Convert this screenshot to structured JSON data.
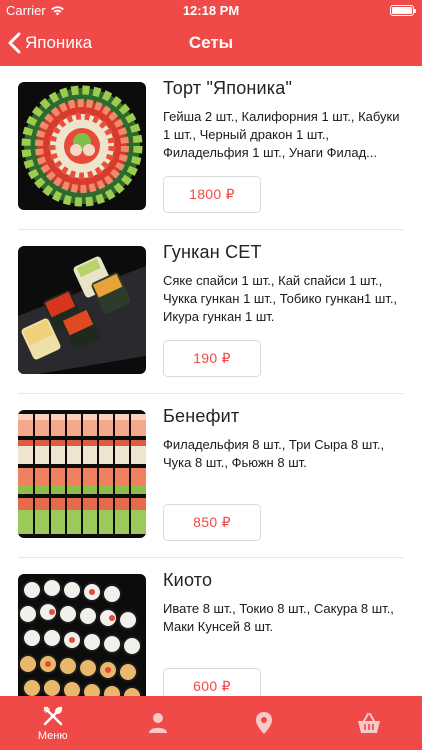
{
  "status_bar": {
    "carrier": "Carrier",
    "time": "12:18 PM"
  },
  "nav": {
    "back_label": "Японика",
    "title": "Сеты"
  },
  "items": [
    {
      "name": "Торт \"Японика\"",
      "description": "Гейша 2 шт., Калифорния 1 шт., Кабуки 1 шт., Черный дракон 1 шт., Филадельфия 1 шт., Унаги Филад...",
      "price": "1800 ₽"
    },
    {
      "name": "Гункан СЕТ",
      "description": "Сяке спайси 1 шт., Кай спайси 1 шт., Чукка гункан 1 шт., Тобико гункан1 шт., Икура гункан 1 шт.",
      "price": "190 ₽"
    },
    {
      "name": "Бенефит",
      "description": "Филадельфия 8 шт., Три Сыра 8 шт., Чука 8 шт., Фьюжн 8 шт.",
      "price": "850 ₽"
    },
    {
      "name": "Киото",
      "description": "Ивате 8 шт., Токио 8 шт., Сакура 8 шт., Маки Кунсей 8 шт.",
      "price": "600 ₽"
    }
  ],
  "tabs": [
    {
      "label": "Меню",
      "icon": "fork-knife-icon"
    },
    {
      "label": "",
      "icon": "user-icon"
    },
    {
      "label": "",
      "icon": "location-pin-icon"
    },
    {
      "label": "",
      "icon": "basket-icon"
    }
  ],
  "colors": {
    "accent": "#ef4a48",
    "background": "#ffffff"
  }
}
